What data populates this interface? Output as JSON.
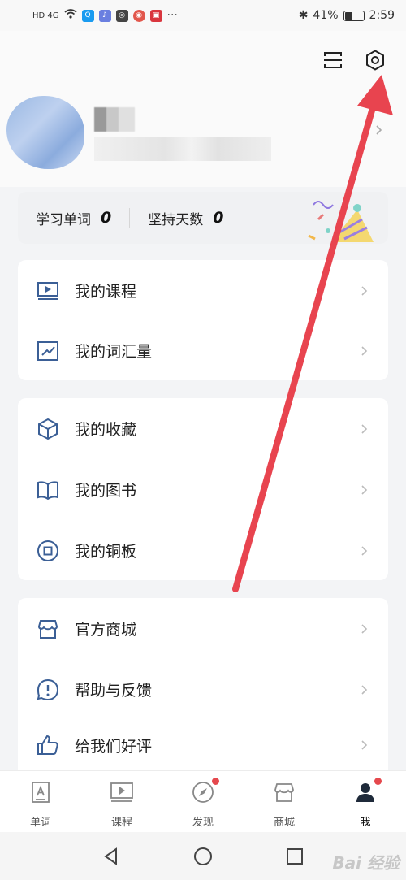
{
  "status": {
    "network": "HD 4G",
    "bluetooth": "✱",
    "battery": "41%",
    "battery_level": 0.41,
    "time": "2:59",
    "more": "···"
  },
  "profile": {
    "icons": [
      "scan-icon",
      "settings-icon"
    ]
  },
  "stats": {
    "words_label": "学习单词",
    "words_value": "0",
    "days_label": "坚持天数",
    "days_value": "0"
  },
  "menu": {
    "course": "我的课程",
    "vocab": "我的词汇量",
    "favorites": "我的收藏",
    "books": "我的图书",
    "coins": "我的铜板",
    "store": "官方商城",
    "help": "帮助与反馈",
    "rate": "给我们好评"
  },
  "tabs": [
    {
      "label": "单词",
      "icon": "word-icon"
    },
    {
      "label": "课程",
      "icon": "course-icon"
    },
    {
      "label": "发现",
      "icon": "compass-icon"
    },
    {
      "label": "商城",
      "icon": "store-icon"
    },
    {
      "label": "我",
      "icon": "user-icon"
    }
  ],
  "watermark": "Bai 经验",
  "colors": {
    "accent": "#3b5f96",
    "annotation_arrow": "#e8444f",
    "badge": "#e5484d"
  }
}
